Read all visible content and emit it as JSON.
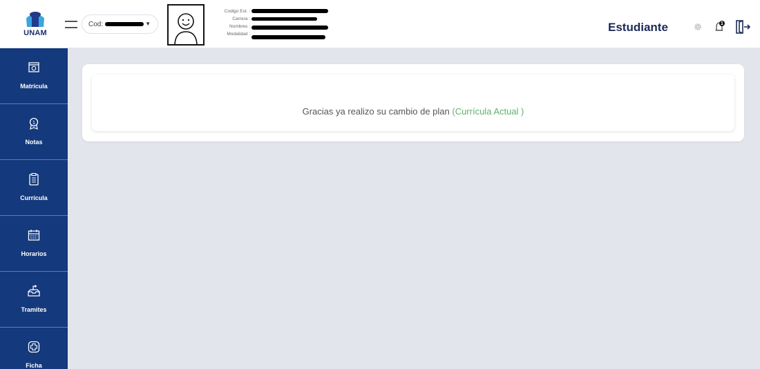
{
  "header": {
    "logo_text": "UNAM",
    "cod_label": "Cod:",
    "student_info_labels": [
      "Codigo Est. :",
      "Carrera :",
      "Nombres :",
      "Modalidad :"
    ],
    "role_title": "Estudiante",
    "notification_count": "1"
  },
  "sidebar": {
    "items": [
      {
        "label": "Matrícula",
        "icon": "enrollment-icon"
      },
      {
        "label": "Notas",
        "icon": "grades-medal-icon"
      },
      {
        "label": "Currícula",
        "icon": "curriculum-clipboard-icon"
      },
      {
        "label": "Horarios",
        "icon": "schedule-calendar-icon"
      },
      {
        "label": "Tramites",
        "icon": "procedures-tray-icon"
      },
      {
        "label": "Ficha",
        "icon": "medical-form-icon"
      }
    ]
  },
  "main": {
    "message_text": "Gracias ya realizo su cambio de plan ",
    "message_accent": "(Currícula Actual )"
  },
  "colors": {
    "sidebar_bg": "#14397c",
    "page_bg": "#e3e5ed",
    "accent_green": "#5bb26a",
    "title_navy": "#1c2a58"
  }
}
